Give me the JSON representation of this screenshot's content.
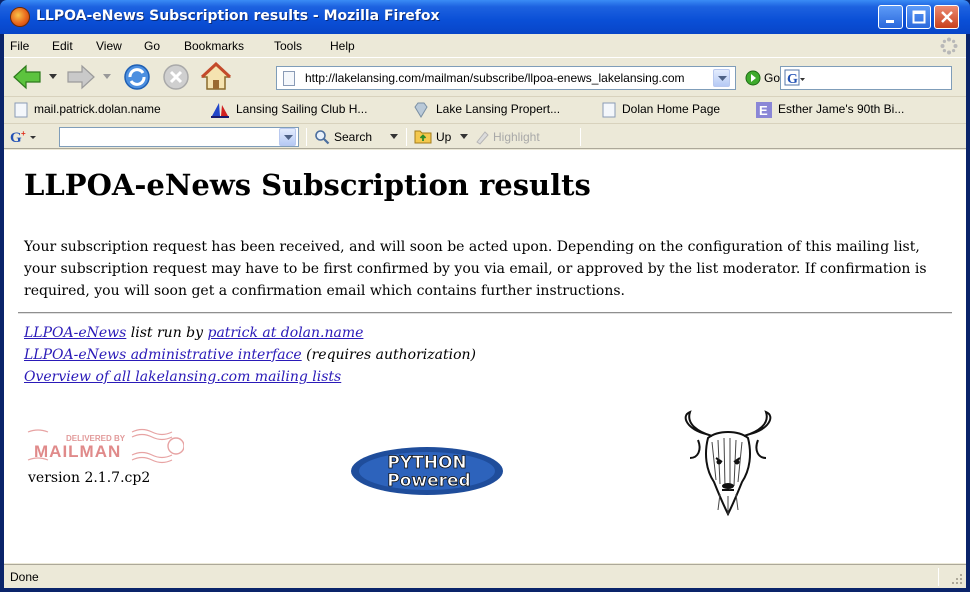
{
  "window": {
    "title": "LLPOA-eNews Subscription results - Mozilla Firefox"
  },
  "menubar": {
    "items": [
      "File",
      "Edit",
      "View",
      "Go",
      "Bookmarks",
      "Tools",
      "Help"
    ]
  },
  "navbar": {
    "url": "http://lakelansing.com/mailman/subscribe/llpoa-enews_lakelansing.com",
    "go_label": "Go",
    "search_value": ""
  },
  "bookmarks": {
    "items": [
      {
        "label": "mail.patrick.dolan.name",
        "icon": "page-icon"
      },
      {
        "label": "Lansing Sailing Club H...",
        "icon": "sailboat-icon"
      },
      {
        "label": "Lake Lansing Propert...",
        "icon": "diamond-icon"
      },
      {
        "label": "Dolan Home Page",
        "icon": "page-icon"
      },
      {
        "label": "Esther Jame's 90th Bi...",
        "icon": "e-icon"
      }
    ]
  },
  "google_toolbar": {
    "query": "",
    "search_label": "Search",
    "up_label": "Up",
    "highlight_label": "Highlight"
  },
  "page": {
    "title": "LLPOA-eNews Subscription results",
    "body": "Your subscription request has been received, and will soon be acted upon. Depending on the configuration of this mailing list, your subscription request may have to be first confirmed by you via email, or approved by the list moderator. If confirmation is required, you will soon get a confirmation email which contains further instructions.",
    "list_link": "LLPOA-eNews",
    "run_by_text": " list run by ",
    "owner_link": "patrick at dolan.name",
    "admin_link": "LLPOA-eNews administrative interface",
    "admin_note": " (requires authorization)",
    "overview_link": "Overview of all lakelansing.com mailing lists",
    "mailman_logo_text": "MAILMAN",
    "mailman_logo_small": "DELIVERED BY",
    "python_logo_line1": "PYTHON",
    "python_logo_line2": "Powered",
    "version": "version 2.1.7.cp2"
  },
  "status": {
    "text": "Done"
  },
  "colors": {
    "link": "#2a1ab8",
    "titlebar": "#0a4fd6",
    "chrome": "#ece9d8"
  }
}
